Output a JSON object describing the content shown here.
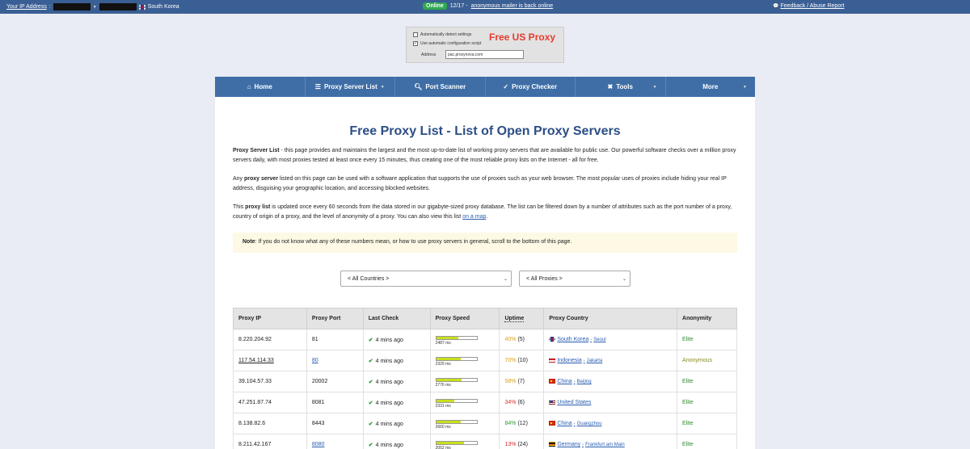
{
  "topbar": {
    "ip_label": "Your IP Address",
    "country": "South Korea",
    "online_badge": "Online",
    "date": "12/17 -",
    "announcement": "anonymous mailer is back online",
    "feedback": "Feedback / Abuse Report"
  },
  "ad": {
    "opt1": "Automatically detect settings",
    "opt2": "Use automatic configuration script",
    "title": "Free US Proxy",
    "address_label": "Address",
    "address_value": "pac.proxynova.com"
  },
  "nav": {
    "items": [
      {
        "label": "Home"
      },
      {
        "label": "Proxy Server List"
      },
      {
        "label": "Port Scanner"
      },
      {
        "label": "Proxy Checker"
      },
      {
        "label": "Tools"
      },
      {
        "label": "More"
      }
    ]
  },
  "main": {
    "title": "Free Proxy List - List of Open Proxy Servers",
    "p1_bold": "Proxy Server List",
    "p1_text": " - this page provides and maintains the largest and the most up-to-date list of working proxy servers that are available for public use. Our powerful software checks over a million proxy servers daily, with most proxies tested at least once every 15 minutes, thus creating one of the most reliable proxy lists on the Internet - all for free.",
    "p2_pre": "Any ",
    "p2_bold": "proxy server",
    "p2_text": " listed on this page can be used with a software application that supports the use of proxies such as your web browser. The most popular uses of proxies include hiding your real IP address, disguising your geographic location, and accessing blocked websites.",
    "p3_pre": "This ",
    "p3_bold": "proxy list",
    "p3_text": " is updated once every 60 seconds from the data stored in our gigabyte-sized proxy database. The list can be filtered down by a number of attributes such as the port number of a proxy, country of origin of a proxy, and the level of anonymity of a proxy. You can also view this list ",
    "p3_link": "on a map",
    "p3_end": ".",
    "note_bold": "Note",
    "note_text": ": If you do not know what any of these numbers mean, or how to use proxy servers in general, scroll to the bottom of this page.",
    "select_country": "< All Countries >",
    "select_proxies": "< All Proxies >"
  },
  "table": {
    "headers": [
      "Proxy IP",
      "Proxy Port",
      "Last Check",
      "Proxy Speed",
      "Uptime",
      "Proxy Country",
      "Anonymity"
    ],
    "rows": [
      {
        "ip": "8.220.204.92",
        "port": "81",
        "check": "4 mins ago",
        "speed_ms": "2487 ms",
        "speed_fill": 0.55,
        "uptime_pct": "40%",
        "uptime_count": "(5)",
        "uptime_color": "#d9a21b",
        "country": "South Korea",
        "city": "Seoul",
        "flag": "kr",
        "anon": "Elite",
        "anon_color": "#2f8a2f",
        "ip_underline": false,
        "port_link": false
      },
      {
        "ip": "117.54.114.33",
        "port": "80",
        "check": "4 mins ago",
        "speed_ms": "2329 ms",
        "speed_fill": 0.6,
        "uptime_pct": "70%",
        "uptime_count": "(10)",
        "uptime_color": "#d9a21b",
        "country": "Indonesia",
        "city": "Jakarta",
        "flag": "id",
        "anon": "Anonymous",
        "anon_color": "#8a8a1f",
        "ip_underline": true,
        "port_link": true
      },
      {
        "ip": "39.104.57.33",
        "port": "20002",
        "check": "4 mins ago",
        "speed_ms": "2776 ms",
        "speed_fill": 0.62,
        "uptime_pct": "58%",
        "uptime_count": "(7)",
        "uptime_color": "#d9a21b",
        "country": "China",
        "city": "Beijing",
        "flag": "cn",
        "anon": "Elite",
        "anon_color": "#2f8a2f",
        "ip_underline": false,
        "port_link": false
      },
      {
        "ip": "47.251.87.74",
        "port": "8081",
        "check": "4 mins ago",
        "speed_ms": "2331 ms",
        "speed_fill": 0.45,
        "uptime_pct": "34%",
        "uptime_count": "(6)",
        "uptime_color": "#d3322b",
        "country": "United States",
        "city": "",
        "flag": "us",
        "anon": "Elite",
        "anon_color": "#2f8a2f",
        "ip_underline": false,
        "port_link": false
      },
      {
        "ip": "8.138.82.6",
        "port": "8443",
        "check": "4 mins ago",
        "speed_ms": "2660 ms",
        "speed_fill": 0.6,
        "uptime_pct": "84%",
        "uptime_count": "(12)",
        "uptime_color": "#2f9a36",
        "country": "China",
        "city": "Guangzhou",
        "flag": "cn",
        "anon": "Elite",
        "anon_color": "#2f8a2f",
        "ip_underline": false,
        "port_link": false
      },
      {
        "ip": "8.211.42.167",
        "port": "8080",
        "check": "4 mins ago",
        "speed_ms": "2052 ms",
        "speed_fill": 0.68,
        "uptime_pct": "13%",
        "uptime_count": "(24)",
        "uptime_color": "#d3322b",
        "country": "Germany",
        "city": "Frankfurt am Main",
        "flag": "de",
        "anon": "Elite",
        "anon_color": "#2f8a2f",
        "ip_underline": false,
        "port_link": true
      }
    ]
  }
}
